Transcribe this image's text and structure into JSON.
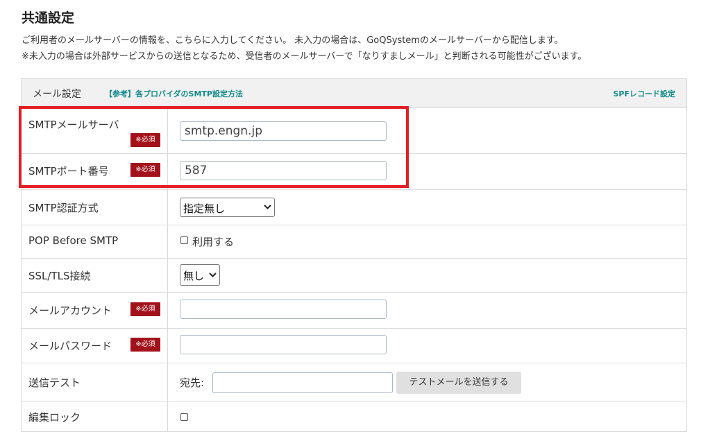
{
  "page": {
    "title": "共通設定",
    "description_1": "ご利用者のメールサーバーの情報を、こちらに入力してください。 未入力の場合は、GoQSystemのメールサーバーから配信します。",
    "description_2": "※未入力の場合は外部サービスからの送信となるため、受信者のメールサーバーで「なりすましメール」と判断される可能性がございます。"
  },
  "mail_settings": {
    "header_title": "メール設定",
    "reference_link": "【参考】各プロバイダのSMTP設定方法",
    "spf_link": "SPFレコード設定",
    "required_badge": "※必須",
    "rows": {
      "smtp_server": {
        "label": "SMTPメールサーバ",
        "value": "smtp.engn.jp",
        "required": true
      },
      "smtp_port": {
        "label": "SMTPポート番号",
        "value": "587",
        "required": true
      },
      "smtp_auth": {
        "label": "SMTP認証方式",
        "selected": "指定無し"
      },
      "pop_before_smtp": {
        "label": "POP Before SMTP",
        "checkbox_label": "利用する",
        "checked": false
      },
      "ssl_tls": {
        "label": "SSL/TLS接続",
        "selected": "無し"
      },
      "mail_account": {
        "label": "メールアカウント",
        "value": "",
        "required": true
      },
      "mail_password": {
        "label": "メールパスワード",
        "value": "",
        "required": true
      },
      "send_test": {
        "label": "送信テスト",
        "to_label": "宛先:",
        "to_value": "",
        "button_label": "テストメールを送信する"
      },
      "edit_lock": {
        "label": "編集ロック",
        "checked": false
      }
    }
  },
  "colors": {
    "required_badge": "#a3121b",
    "link": "#128a8a",
    "highlight_border": "#e31e24"
  }
}
